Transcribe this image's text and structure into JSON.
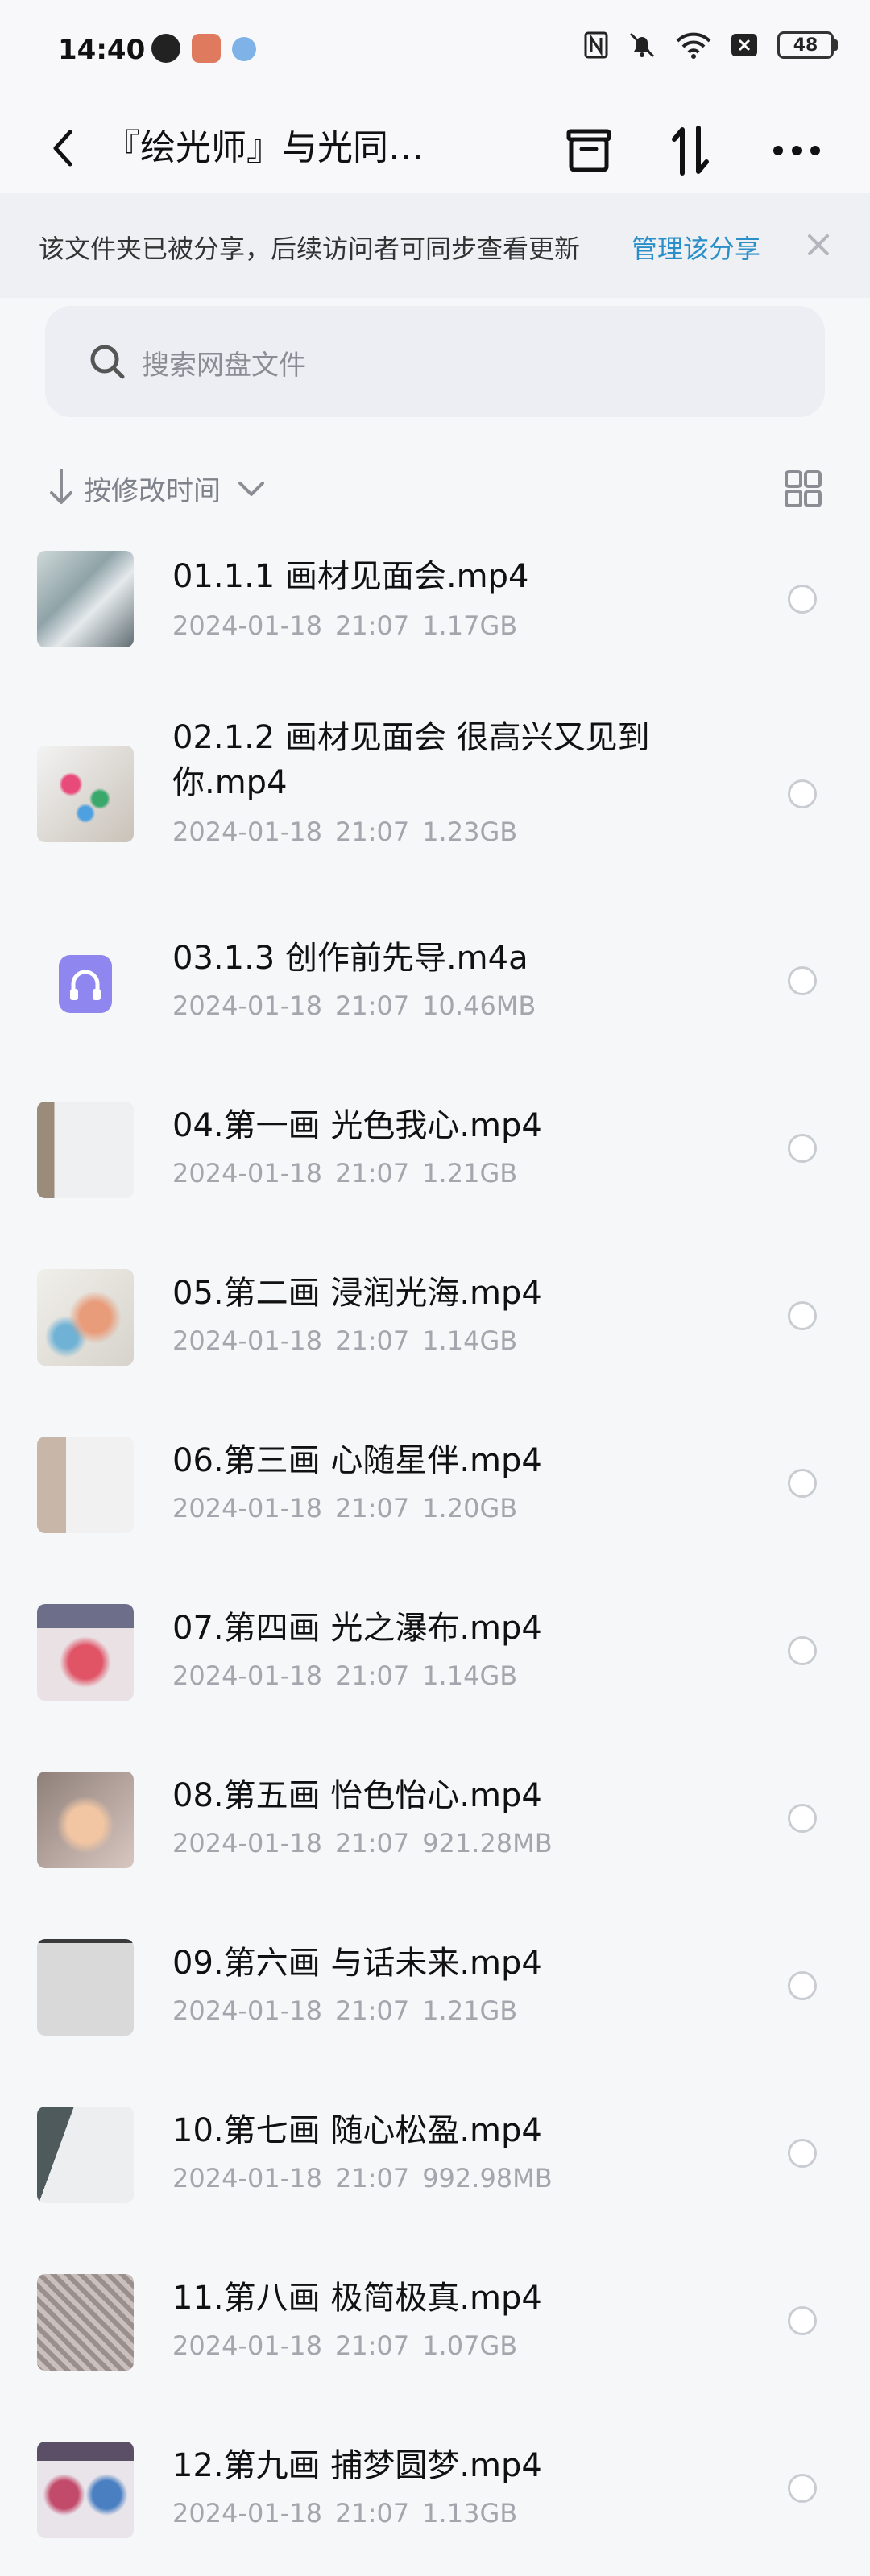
{
  "status_bar": {
    "time": "14:40",
    "battery": "48"
  },
  "nav": {
    "title": "『绘光师』与光同…",
    "icons": [
      "back-arrow-icon",
      "archive-icon",
      "sort-transfer-icon",
      "more-icon"
    ]
  },
  "share_banner": {
    "text": "该文件夹已被分享，后续访问者可同步查看更新",
    "link": "管理该分享"
  },
  "search": {
    "placeholder": "搜索网盘文件"
  },
  "sort": {
    "label": "按修改时间"
  },
  "files": [
    {
      "name": "01.1.1 画材见面会.mp4",
      "date": "2024-01-18",
      "time": "21:07",
      "size": "1.17GB",
      "thumb": "video"
    },
    {
      "name": "02.1.2 画材见面会 很高兴又见到你.mp4",
      "date": "2024-01-18",
      "time": "21:07",
      "size": "1.23GB",
      "thumb": "video"
    },
    {
      "name": "03.1.3 创作前先导.m4a",
      "date": "2024-01-18",
      "time": "21:07",
      "size": "10.46MB",
      "thumb": "audio"
    },
    {
      "name": "04.第一画 光色我心.mp4",
      "date": "2024-01-18",
      "time": "21:07",
      "size": "1.21GB",
      "thumb": "video"
    },
    {
      "name": "05.第二画 浸润光海.mp4",
      "date": "2024-01-18",
      "time": "21:07",
      "size": "1.14GB",
      "thumb": "video"
    },
    {
      "name": "06.第三画 心随星伴.mp4",
      "date": "2024-01-18",
      "time": "21:07",
      "size": "1.20GB",
      "thumb": "video"
    },
    {
      "name": "07.第四画 光之瀑布.mp4",
      "date": "2024-01-18",
      "time": "21:07",
      "size": "1.14GB",
      "thumb": "video"
    },
    {
      "name": "08.第五画 怡色怡心.mp4",
      "date": "2024-01-18",
      "time": "21:07",
      "size": "921.28MB",
      "thumb": "video"
    },
    {
      "name": "09.第六画 与话未来.mp4",
      "date": "2024-01-18",
      "time": "21:07",
      "size": "1.21GB",
      "thumb": "video"
    },
    {
      "name": "10.第七画 随心松盈.mp4",
      "date": "2024-01-18",
      "time": "21:07",
      "size": "992.98MB",
      "thumb": "video"
    },
    {
      "name": "11.第八画 极简极真.mp4",
      "date": "2024-01-18",
      "time": "21:07",
      "size": "1.07GB",
      "thumb": "video"
    },
    {
      "name": "12.第九画 捕梦圆梦.mp4",
      "date": "2024-01-18",
      "time": "21:07",
      "size": "1.13GB",
      "thumb": "video"
    }
  ],
  "colors": {
    "accent_link": "#2a8fc9",
    "audio_icon": "#8f86f0"
  }
}
